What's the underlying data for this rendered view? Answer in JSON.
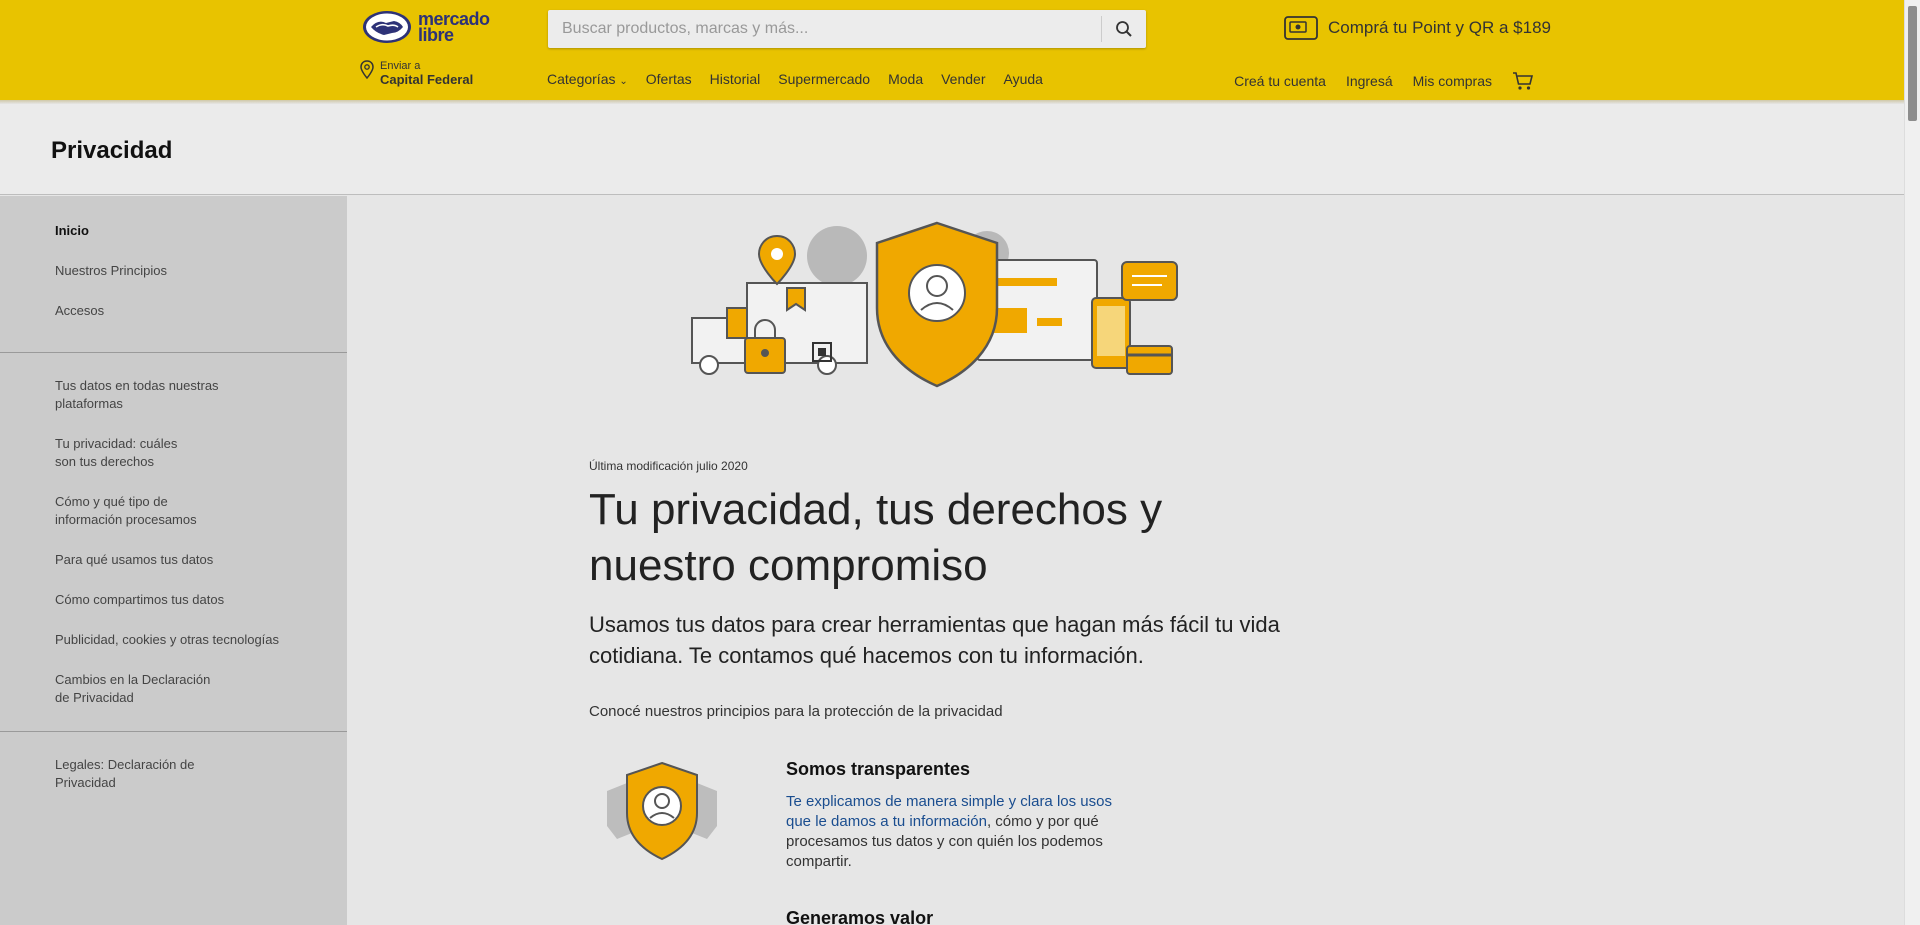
{
  "header": {
    "logo_text": "mercado libre",
    "search_placeholder": "Buscar productos, marcas y más...",
    "promo": "Comprá tu Point y QR a $189",
    "shipping_label": "Enviar a",
    "shipping_location": "Capital Federal",
    "nav": [
      "Categorías",
      "Ofertas",
      "Historial",
      "Supermercado",
      "Moda",
      "Vender",
      "Ayuda"
    ],
    "user_nav": [
      "Creá tu cuenta",
      "Ingresá",
      "Mis compras"
    ],
    "colors": {
      "brand_yellow": "#e8c300",
      "logo_blue": "#2d3277"
    }
  },
  "page_title": "Privacidad",
  "sidebar": {
    "group1": [
      "Inicio",
      "Nuestros Principios",
      "Accesos"
    ],
    "group2": [
      "Tus datos en todas nuestras plataformas",
      "Tu privacidad: cuáles son tus derechos",
      "Cómo y qué tipo de información procesamos",
      "Para qué usamos tus datos",
      "Cómo compartimos tus datos",
      "Publicidad, cookies y otras tecnologías",
      "Cambios en la Declaración de Privacidad"
    ],
    "group3": [
      "Legales: Declaración de Privacidad"
    ]
  },
  "main": {
    "updated": "Última modificación julio 2020",
    "heading": "Tu privacidad, tus derechos y nuestro compromiso",
    "lead": "Usamos tus datos para crear herramientas que hagan más fácil tu vida cotidiana. Te contamos qué hacemos con tu información.",
    "principles_intro": "Conocé nuestros principios para la protección de la privacidad",
    "principle1": {
      "title": "Somos transparentes",
      "body_highlight": "Te explicamos de manera simple y clara los usos que le damos a tu información",
      "body_rest": ", cómo y por qué procesamos tus datos y con quién los podemos compartir."
    },
    "principle2_title": "Generamos valor"
  }
}
